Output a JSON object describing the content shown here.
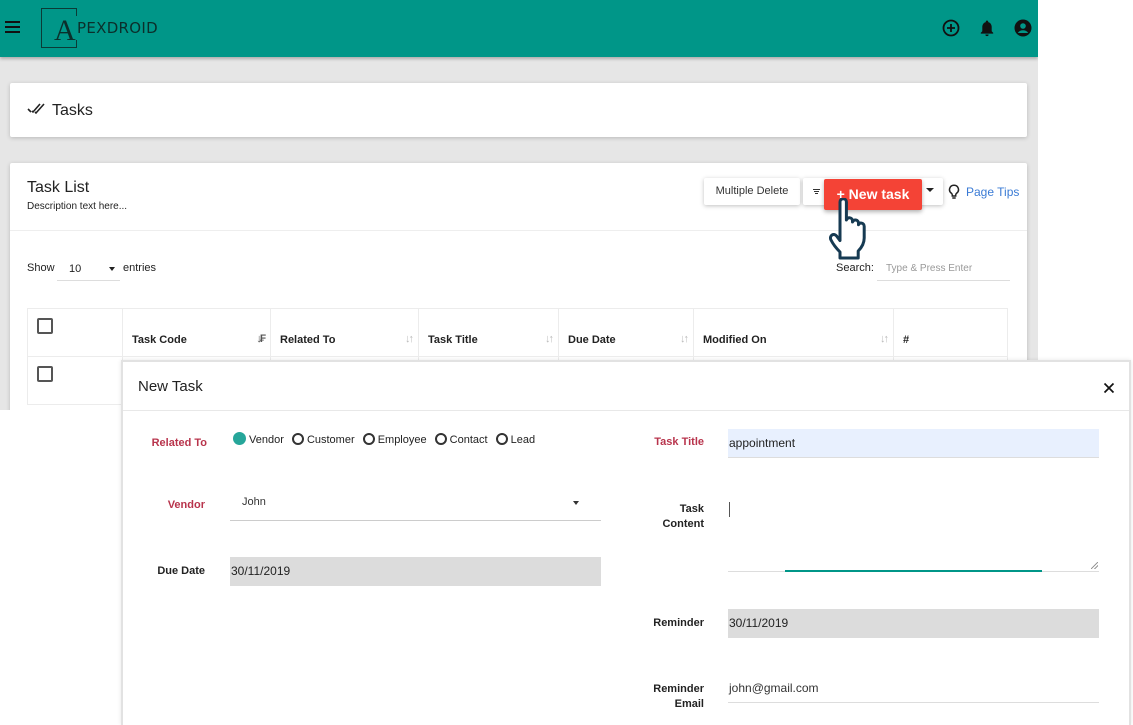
{
  "header": {
    "brand_initial": "A",
    "brand_rest": "PEXDROID",
    "icons": [
      "menu-icon",
      "add-circle-icon",
      "bell-icon",
      "account-icon"
    ]
  },
  "page": {
    "title": "Tasks",
    "title_icon": "double-check-icon"
  },
  "task_list": {
    "title": "Task List",
    "description": "Description text here...",
    "multiple_delete_label": "Multiple Delete",
    "new_task_label": "+ New task",
    "page_tips_label": "Page Tips",
    "show_label": "Show",
    "entries_value": "10",
    "entries_label": "entries",
    "search_label": "Search:",
    "search_placeholder": "Type & Press Enter",
    "columns": [
      "Task Code",
      "Related To",
      "Task Title",
      "Due Date",
      "Modified On",
      "#"
    ]
  },
  "modal": {
    "title": "New Task",
    "related_to_label": "Related To",
    "related_options": [
      {
        "label": "Vendor",
        "selected": true
      },
      {
        "label": "Customer",
        "selected": false
      },
      {
        "label": "Employee",
        "selected": false
      },
      {
        "label": "Contact",
        "selected": false
      },
      {
        "label": "Lead",
        "selected": false
      }
    ],
    "vendor_label": "Vendor",
    "vendor_value": "John",
    "due_date_label": "Due Date",
    "due_date_value": "30/11/2019",
    "task_title_label": "Task Title",
    "task_title_value": "appointment",
    "task_content_label_line1": "Task",
    "task_content_label_line2": "Content",
    "task_content_value": "",
    "reminder_label": "Reminder",
    "reminder_value": "30/11/2019",
    "reminder_email_label_line1": "Reminder",
    "reminder_email_label_line2": "Email",
    "reminder_email_value": "john@gmail.com"
  },
  "colors": {
    "brand": "#009688",
    "primary_button": "#f44336",
    "required_label": "#b8344c",
    "link": "#3a7bd5"
  }
}
